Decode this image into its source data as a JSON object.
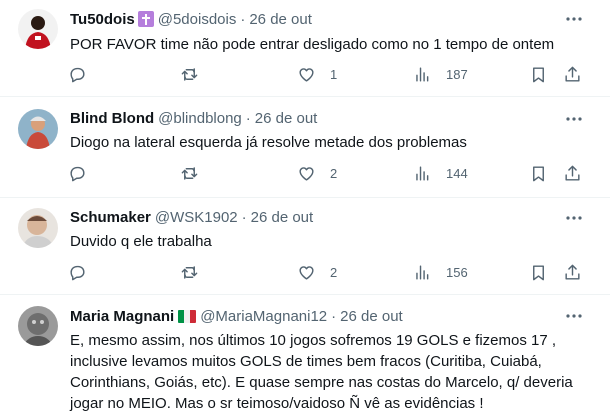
{
  "tweets": [
    {
      "name": "Tu50dois",
      "handle": "@5doisdois",
      "time": "26 de out",
      "text": "POR FAVOR time não pode entrar desligado como no 1 tempo de ontem",
      "likes": "1",
      "views": "187"
    },
    {
      "name": "Blind Blond",
      "handle": "@blindblong",
      "time": "26 de out",
      "text": "Diogo na lateral esquerda já resolve metade dos problemas",
      "likes": "2",
      "views": "144"
    },
    {
      "name": "Schumaker",
      "handle": "@WSK1902",
      "time": "26 de out",
      "text": "Duvido q ele trabalha",
      "likes": "2",
      "views": "156"
    },
    {
      "name": "Maria Magnani",
      "handle": "@MariaMagnani12",
      "time": "26 de out",
      "text_lines": [
        "E, mesmo assim, nos últimos 10 jogos sofremos 19 GOLS e fizemos 17 ,",
        "inclusive levamos muitos GOLS de times bem fracos (Curitiba, Cuiabá,",
        "Corinthians, Goiás, etc). E quase sempre nas costas do Marcelo, q/ deveria",
        "jogar no MEIO. Mas o sr teimoso/vaidoso Ñ vê as evidências !"
      ]
    }
  ],
  "separator": "·",
  "icons": {
    "reply": "reply-icon",
    "retweet": "retweet-icon",
    "like": "heart-icon",
    "views": "views-bar-icon",
    "bookmark": "bookmark-icon",
    "share": "share-icon",
    "more": "more-icon",
    "badge": "latin-cross-emoji",
    "flag": "italy-flag-emoji"
  },
  "colors": {
    "text": "#0f1419",
    "secondary": "#536471",
    "divider": "#eff3f4",
    "badge": "#b57edc"
  }
}
